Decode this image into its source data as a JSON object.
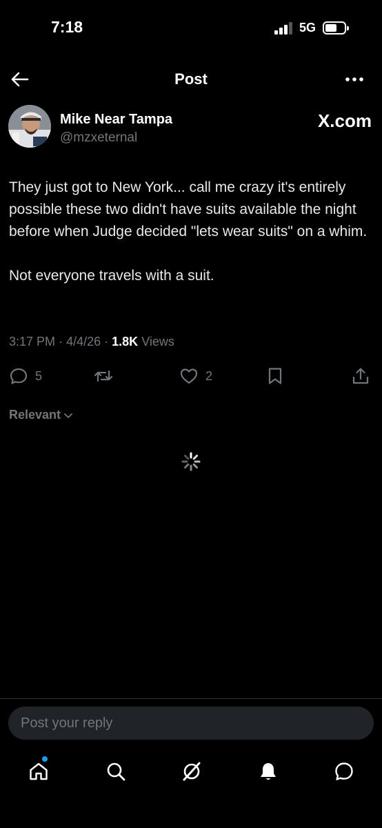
{
  "status_bar": {
    "time": "7:18",
    "network": "5G"
  },
  "header": {
    "title": "Post",
    "back_icon": "arrow-left-icon",
    "more_icon": "more-dots-icon"
  },
  "author": {
    "name": "Mike Near Tampa",
    "handle": "@mzxeternal",
    "brand": "X.com"
  },
  "post": {
    "paragraphs": [
      "They just got to New York... call me crazy it's entirely possible these two didn't have suits available the night before when Judge decided \"lets wear suits\" on a whim.",
      "Not everyone travels with a suit."
    ],
    "time": "3:17 PM",
    "date": "4/4/26",
    "views_count": "1.8K",
    "views_label": "Views",
    "separator": "·"
  },
  "actions": {
    "reply_count": "5",
    "repost_count": "",
    "like_count": "2"
  },
  "sort": {
    "label": "Relevant"
  },
  "reply": {
    "placeholder": "Post your reply"
  },
  "tabs": [
    "home-icon",
    "search-icon",
    "grok-icon",
    "notifications-icon",
    "messages-icon"
  ],
  "colors": {
    "background": "#000000",
    "text": "#e7e9ea",
    "muted": "#71767b",
    "accent": "#1d9bf0",
    "reply_box": "#202327"
  }
}
